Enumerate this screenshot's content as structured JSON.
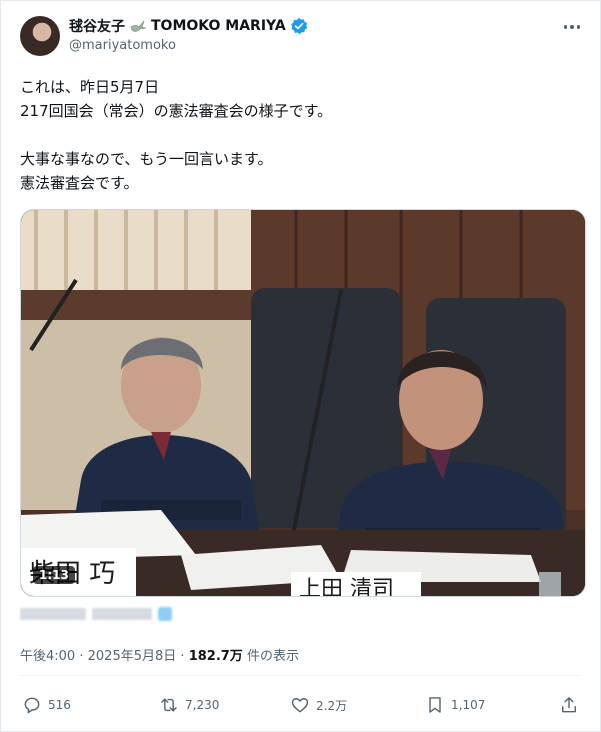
{
  "author": {
    "display_name_jp": "毬谷友子",
    "display_name_en": "TOMOKO MARIYA",
    "handle": "@mariyatomoko"
  },
  "tweet": {
    "lines": [
      "これは、昨日5月7日",
      "217回国会（常会）の憲法審査会の様子です。",
      "大事な事なので、もう一回言います。",
      "憲法審査会です。"
    ]
  },
  "media": {
    "duration": "1:13",
    "nameplate_left": "柴田  巧",
    "nameplate_right": "上田  清司"
  },
  "meta": {
    "time": "午後4:00",
    "separator": "·",
    "date": "2025年5月8日",
    "views_count": "182.7万",
    "views_label": "件の表示"
  },
  "actions": {
    "replies": "516",
    "reposts": "7,230",
    "likes": "2.2万",
    "bookmarks": "1,107"
  },
  "icons": [
    "dove-icon",
    "verified-icon",
    "more-icon",
    "reply-icon",
    "repost-icon",
    "like-icon",
    "bookmark-icon",
    "share-icon"
  ],
  "colors": {
    "verified": "#1d9bf0",
    "secondary_text": "#536471",
    "primary_text": "#0f1419"
  }
}
